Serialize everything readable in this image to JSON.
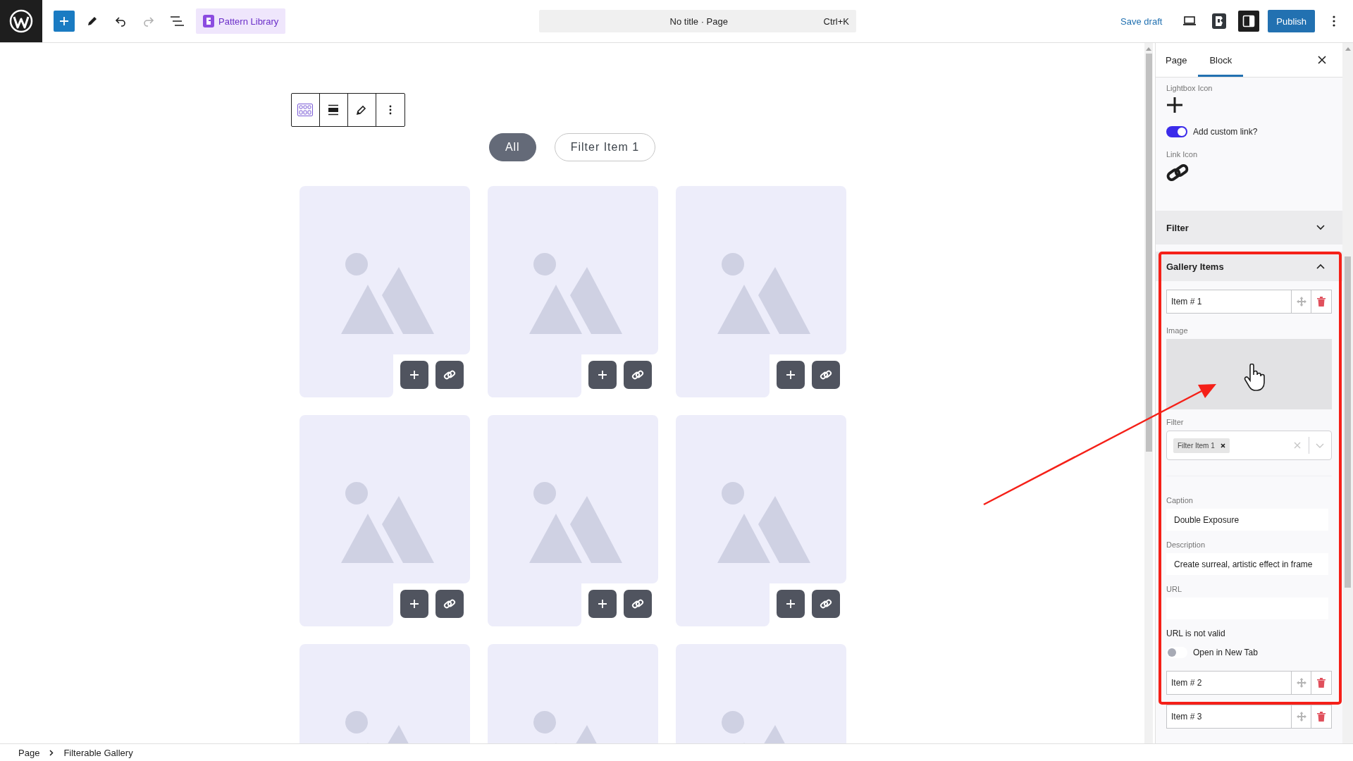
{
  "top_bar": {
    "pattern_library": "Pattern Library",
    "command": {
      "title": "No title · Page",
      "shortcut": "Ctrl+K"
    },
    "save_draft": "Save draft",
    "publish": "Publish",
    "settings_open": true
  },
  "filters": [
    {
      "label": "All",
      "selected": true
    },
    {
      "label": "Filter Item 1",
      "selected": false
    }
  ],
  "gallery": {
    "cards": [
      {
        "kind": "placeholder"
      },
      {
        "kind": "placeholder"
      },
      {
        "kind": "placeholder"
      },
      {
        "kind": "placeholder"
      },
      {
        "kind": "placeholder"
      },
      {
        "kind": "placeholder"
      },
      {
        "kind": "partial"
      },
      {
        "kind": "partial"
      },
      {
        "kind": "partial"
      }
    ]
  },
  "sidebar": {
    "tabs": [
      {
        "label": "Page",
        "selected": false
      },
      {
        "label": "Block",
        "selected": true
      }
    ],
    "lightbox_icon_label": "Lightbox Icon",
    "custom_link": {
      "label": "Add custom link?",
      "on": true
    },
    "link_icon_label": "Link Icon",
    "panels": [
      {
        "title": "Filter",
        "expanded": false
      },
      {
        "title": "Gallery Items",
        "expanded": true
      }
    ],
    "gallery_items": [
      {
        "title": "Item # 1",
        "expanded": true,
        "image_label": "Image",
        "filter_label": "Filter",
        "filter_tags": [
          "Filter Item 1"
        ],
        "caption_label": "Caption",
        "caption": "Double Exposure",
        "description_label": "Description",
        "description": "Create surreal, artistic effect in frame",
        "url_label": "URL",
        "url_error": "URL is not valid",
        "new_tab": {
          "label": "Open in New Tab",
          "on": false
        }
      },
      {
        "title": "Item # 2",
        "expanded": false
      },
      {
        "title": "Item # 3",
        "expanded": false
      }
    ]
  },
  "breadcrumb": [
    "Page",
    "Filterable Gallery"
  ]
}
